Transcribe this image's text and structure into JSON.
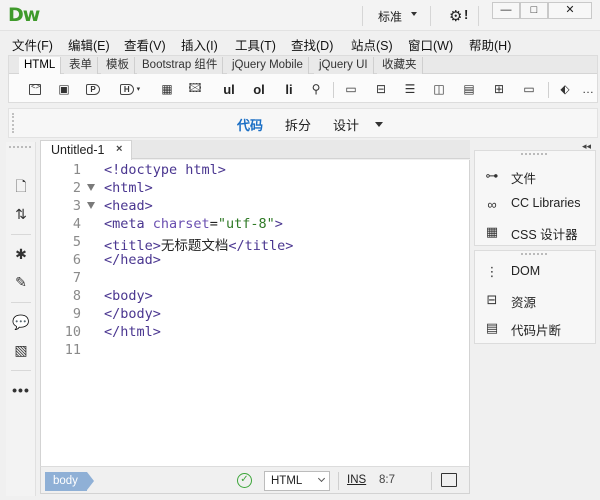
{
  "app": {
    "logo": "Dw",
    "workspace": "标准"
  },
  "window": {
    "settings_icon": "gear-icon",
    "alert_mark": "!",
    "minimize": "—",
    "maximize": "□",
    "close": "✕"
  },
  "menu": [
    "文件(F)",
    "编辑(E)",
    "查看(V)",
    "插入(I)",
    "工具(T)",
    "查找(D)",
    "站点(S)",
    "窗口(W)",
    "帮助(H)"
  ],
  "insert_panel": {
    "tabs": [
      "HTML",
      "表单",
      "模板",
      "Bootstrap 组件",
      "jQuery Mobile",
      "jQuery UI",
      "收藏夹"
    ],
    "active_tab": "HTML",
    "text_buttons": {
      "ul": "ul",
      "ol": "ol",
      "li": "li"
    }
  },
  "view": {
    "code": "代码",
    "split": "拆分",
    "design": "设计"
  },
  "document": {
    "tab": "Untitled-1",
    "close": "×"
  },
  "code_lines": [
    {
      "n": "1",
      "fold": false
    },
    {
      "n": "2",
      "fold": true
    },
    {
      "n": "3",
      "fold": true
    },
    {
      "n": "4",
      "fold": false
    },
    {
      "n": "5",
      "fold": false
    },
    {
      "n": "6",
      "fold": false
    },
    {
      "n": "7",
      "fold": false
    },
    {
      "n": "8",
      "fold": false
    },
    {
      "n": "9",
      "fold": false
    },
    {
      "n": "10",
      "fold": false
    },
    {
      "n": "11",
      "fold": false
    }
  ],
  "code": {
    "l1": "<!doctype html>",
    "l2": "<html>",
    "l3": "<head>",
    "l4_a": "<meta ",
    "l4_b": "charset",
    "l4_c": "=",
    "l4_d": "\"utf-8\"",
    "l4_e": ">",
    "l5_a": "<title>",
    "l5_b": "无标题文档",
    "l5_c": "</title>",
    "l6": "</head>",
    "l8": "<body>",
    "l9": "</body>",
    "l10": "</html>"
  },
  "statusbar": {
    "tag": "body",
    "doctype": "HTML",
    "ins": "INS",
    "cursor": "8:7"
  },
  "right_panel": {
    "top": [
      {
        "label": "文件",
        "icon": "sitemap-icon"
      },
      {
        "label": "CC Libraries",
        "icon": "cc-libraries-icon"
      },
      {
        "label": "CSS 设计器",
        "icon": "css-designer-icon"
      }
    ],
    "bottom": [
      {
        "label": "DOM",
        "icon": "dom-tree-icon"
      },
      {
        "label": "资源",
        "icon": "assets-icon"
      },
      {
        "label": "代码片断",
        "icon": "snippets-icon"
      }
    ]
  },
  "colors": {
    "logo": "#3f9a2b",
    "active_view": "#1b6fc5",
    "tag_selector": "#8fb0d6",
    "tag": "#4a3690",
    "string": "#2f7a26"
  }
}
